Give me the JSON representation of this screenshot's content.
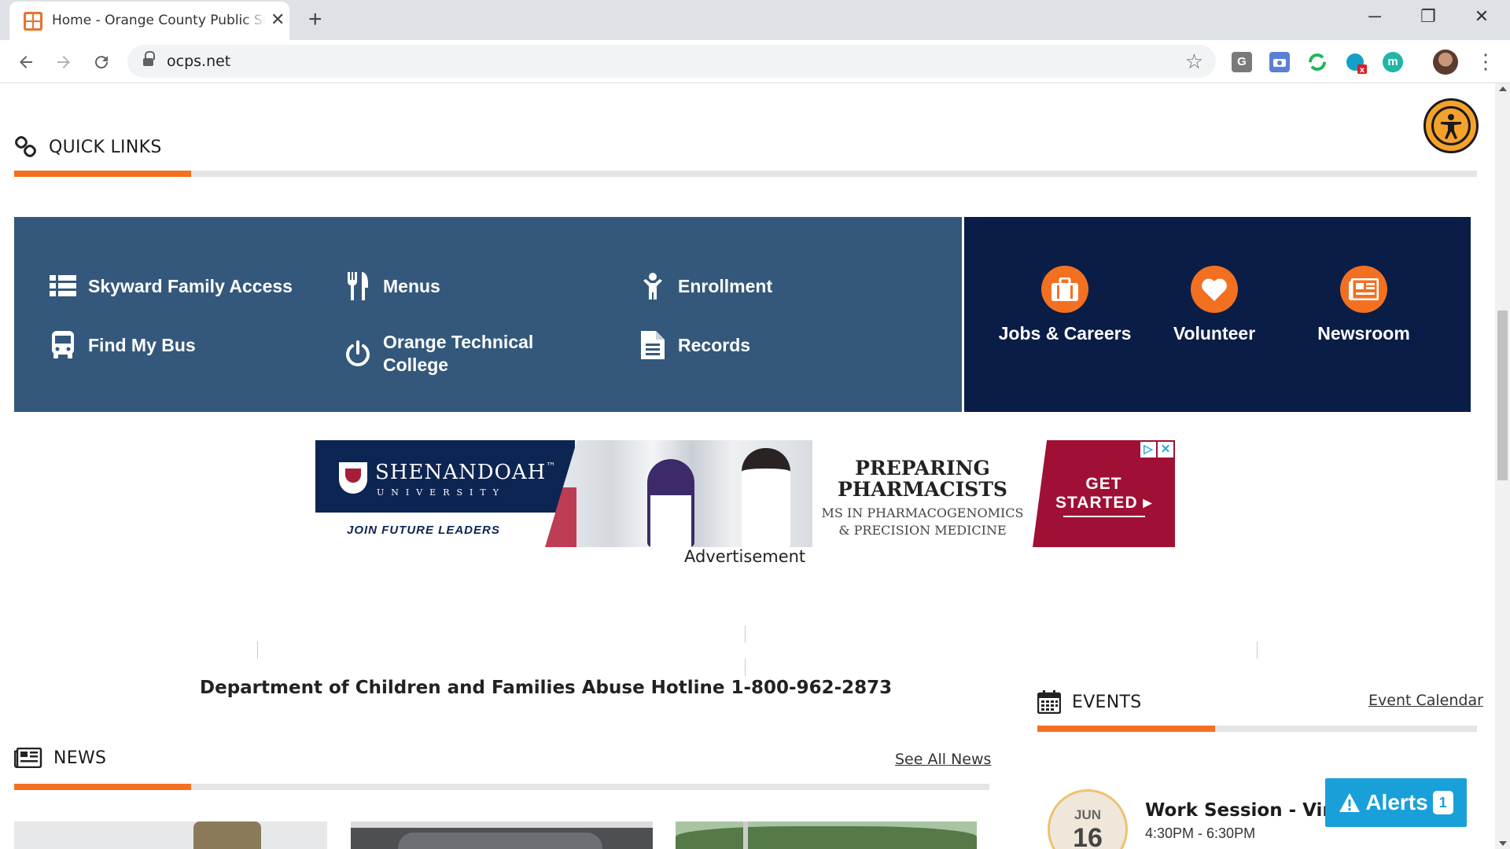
{
  "browser": {
    "tab_title": "Home - Orange County Public Schools",
    "tab_close": "✕",
    "new_tab": "+",
    "url": "ocps.net",
    "minimize": "─",
    "restore": "❐",
    "close": "✕"
  },
  "extensions": [
    {
      "name": "G",
      "color": "#7a7a7a"
    },
    {
      "name": "",
      "color": "#5b7fd6"
    },
    {
      "name": "",
      "color": "#1db954"
    },
    {
      "name": "",
      "color": "#14a0c8"
    },
    {
      "name": "m",
      "color": "#21b5a6"
    }
  ],
  "quick_links": {
    "title": "QUICK LINKS",
    "left_items": [
      {
        "label": "Skyward Family Access",
        "icon": "list-icon"
      },
      {
        "label": "Menus",
        "icon": "utensils-icon"
      },
      {
        "label": "Enrollment",
        "icon": "child-icon"
      },
      {
        "label": "Find My Bus",
        "icon": "bus-icon"
      },
      {
        "label": "Orange Technical College",
        "icon": "power-icon"
      },
      {
        "label": "Records",
        "icon": "document-icon"
      }
    ],
    "right_items": [
      {
        "label": "Jobs & Careers",
        "icon": "briefcase-icon"
      },
      {
        "label": "Volunteer",
        "icon": "heart-icon"
      },
      {
        "label": "Newsroom",
        "icon": "newspaper-icon"
      }
    ]
  },
  "ad": {
    "brand": "SHENANDOAH",
    "brand_tm": "™",
    "brand_sub": "UNIVERSITY",
    "tagline": "JOIN FUTURE LEADERS",
    "headline_1": "PREPARING",
    "headline_2": "PHARMACISTS",
    "sub_1": "MS IN PHARMACOGENOMICS",
    "sub_2": "& PRECISION MEDICINE",
    "cta_1": "GET",
    "cta_2": "STARTED ▸",
    "choice_1": "▷",
    "choice_2": "✕",
    "label": "Advertisement"
  },
  "hotline": "Department of Children and Families Abuse Hotline 1-800-962-2873",
  "news": {
    "title": "NEWS",
    "see_all": "See All News"
  },
  "events": {
    "title": "EVENTS",
    "calendar_link": "Event Calendar",
    "items": [
      {
        "month": "JUN",
        "day": "16",
        "title": "Work Session - Virtual",
        "time": "4:30PM - 6:30PM"
      }
    ]
  },
  "alerts": {
    "label": "Alerts",
    "count": "1"
  },
  "colors": {
    "accent": "#f37021",
    "panel_left": "#34587b",
    "panel_right": "#0a1d47",
    "alerts": "#1aa0d8"
  }
}
